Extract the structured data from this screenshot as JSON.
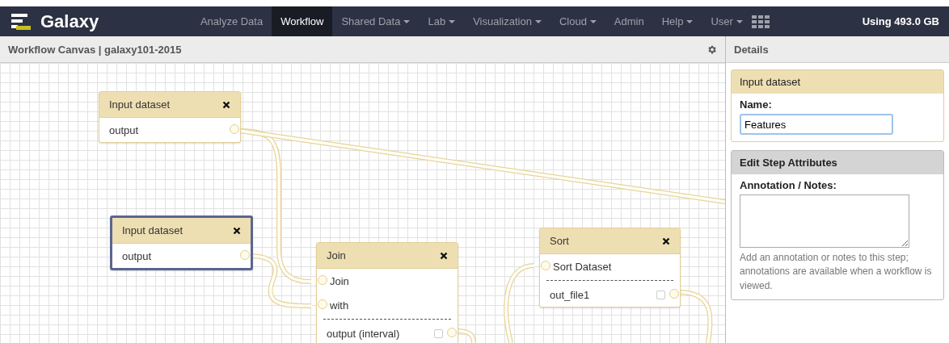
{
  "nav": {
    "brand": "Galaxy",
    "items": [
      {
        "label": "Analyze Data",
        "selected": false,
        "dropdown": false
      },
      {
        "label": "Workflow",
        "selected": true,
        "dropdown": false
      },
      {
        "label": "Shared Data",
        "selected": false,
        "dropdown": true
      },
      {
        "label": "Lab",
        "selected": false,
        "dropdown": true
      },
      {
        "label": "Visualization",
        "selected": false,
        "dropdown": true
      },
      {
        "label": "Cloud",
        "selected": false,
        "dropdown": true
      },
      {
        "label": "Admin",
        "selected": false,
        "dropdown": false
      },
      {
        "label": "Help",
        "selected": false,
        "dropdown": true
      },
      {
        "label": "User",
        "selected": false,
        "dropdown": true
      }
    ],
    "usage": "Using 493.0 GB"
  },
  "canvas": {
    "title": "Workflow Canvas | galaxy101-2015",
    "nodes": [
      {
        "title": "Input dataset",
        "selected": false,
        "outputs": [
          {
            "label": "output"
          }
        ]
      },
      {
        "title": "Input dataset",
        "selected": true,
        "outputs": [
          {
            "label": "output"
          }
        ]
      },
      {
        "title": "Join",
        "selected": false,
        "inputs": [
          {
            "label": "Join"
          },
          {
            "label": "with"
          }
        ],
        "outputs": [
          {
            "label": "output (interval)",
            "checked": false
          }
        ]
      },
      {
        "title": "Sort",
        "selected": false,
        "inputs": [
          {
            "label": "Sort Dataset"
          }
        ],
        "outputs": [
          {
            "label": "out_file1",
            "checked": false
          }
        ]
      }
    ]
  },
  "details": {
    "title": "Details",
    "step": {
      "title": "Input dataset",
      "name_label": "Name:",
      "name_value": "Features"
    },
    "attributes": {
      "title": "Edit Step Attributes",
      "annotation_label": "Annotation / Notes:",
      "help": "Add an annotation or notes to this step; annotations are available when a workflow is viewed."
    }
  }
}
